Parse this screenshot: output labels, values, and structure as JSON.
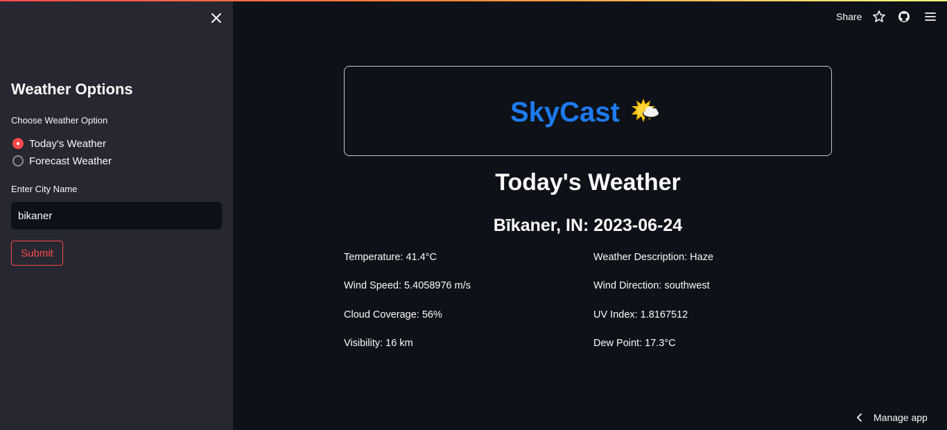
{
  "sidebar": {
    "title": "Weather Options",
    "choose_label": "Choose Weather Option",
    "options": [
      {
        "label": "Today's Weather",
        "selected": true
      },
      {
        "label": "Forecast Weather",
        "selected": false
      }
    ],
    "city_label": "Enter City Name",
    "city_value": "bikaner",
    "submit_label": "Submit"
  },
  "header": {
    "share_label": "Share",
    "icons": [
      "star-icon",
      "github-icon",
      "menu-icon"
    ]
  },
  "main": {
    "app_title": "SkyCast",
    "app_icon": "sun-behind-cloud-icon",
    "heading": "Today's Weather",
    "location": "Bīkaner, IN: 2023-06-24",
    "stats_left": [
      "Temperature: 41.4°C",
      "Wind Speed: 5.4058976 m/s",
      "Cloud Coverage: 56%",
      "Visibility: 16 km"
    ],
    "stats_right": [
      "Weather Description: Haze",
      "Wind Direction: southwest",
      "UV Index: 1.8167512",
      "Dew Point: 17.3°C"
    ]
  },
  "footer": {
    "manage_label": "Manage app"
  },
  "colors": {
    "accent": "#ff4b4b",
    "title_blue": "#1e7bf0",
    "sidebar_bg": "#262730",
    "main_bg": "#0e1117"
  }
}
